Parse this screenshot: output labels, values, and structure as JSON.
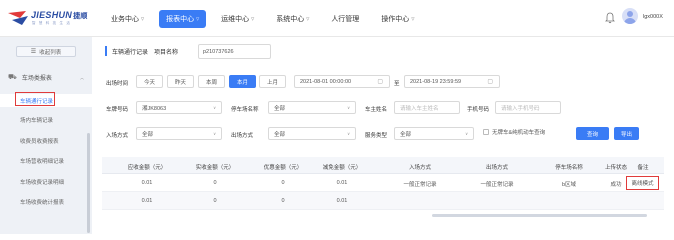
{
  "brand": {
    "name": "JIESHUN",
    "name_cn": "捷顺",
    "tagline": "智 慧 科 技 生 活"
  },
  "nav": [
    {
      "label": "业务中心",
      "active": false
    },
    {
      "label": "报表中心",
      "active": true
    },
    {
      "label": "运维中心",
      "active": false
    },
    {
      "label": "系统中心",
      "active": false
    },
    {
      "label": "人行管理",
      "active": false
    },
    {
      "label": "操作中心",
      "active": false
    }
  ],
  "user": {
    "name": "lgx000X"
  },
  "sidebar": {
    "collapse_label": "收起列表",
    "group_label": "车场类报表",
    "items": [
      {
        "label": "车辆通行记录",
        "active": true
      },
      {
        "label": "场内车辆记录",
        "active": false
      },
      {
        "label": "收费员收费报表",
        "active": false
      },
      {
        "label": "车场营收明细记录",
        "active": false
      },
      {
        "label": "车场收费记录明细",
        "active": false
      },
      {
        "label": "车场收费统计报表",
        "active": false
      }
    ]
  },
  "page": {
    "title": "车辆通行记录",
    "project_label": "项目名称",
    "project_value": "p210737626"
  },
  "filters": {
    "time_label": "出场时间",
    "quick": [
      "今天",
      "昨天",
      "本周",
      "本月",
      "上月"
    ],
    "quick_active": "本月",
    "start": "2021-08-01 00:00:00",
    "to_label": "至",
    "end": "2021-08-19 23:59:59",
    "plate_label": "车牌号码",
    "plate_value": "湘JK8063",
    "lot_label": "停车场名称",
    "lot_value": "全部",
    "owner_label": "车主姓名",
    "owner_placeholder": "请输入车主姓名",
    "phone_label": "手机号码",
    "phone_placeholder": "请输入手机号码",
    "entry_label": "入场方式",
    "entry_value": "全部",
    "exit_label": "出场方式",
    "exit_value": "全部",
    "service_label": "服务类型",
    "service_value": "全部",
    "nonplate_label": "无牌车&纯机动车查询",
    "search_label": "查询",
    "export_label": "导出"
  },
  "table": {
    "headers": [
      "应收金额（元）",
      "实收金额（元）",
      "优惠金额（元）",
      "减免金额（元）",
      "入场方式",
      "出场方式",
      "停车场名称",
      "上传状态",
      "备注"
    ],
    "rows": [
      [
        "0.01",
        "0",
        "0",
        "0.01",
        "一般正常记录",
        "一般正常记录",
        "b区域",
        "成功",
        "离线模式"
      ],
      [
        "0.01",
        "0",
        "0",
        "0.01",
        "",
        "",
        "",
        "",
        ""
      ]
    ]
  }
}
